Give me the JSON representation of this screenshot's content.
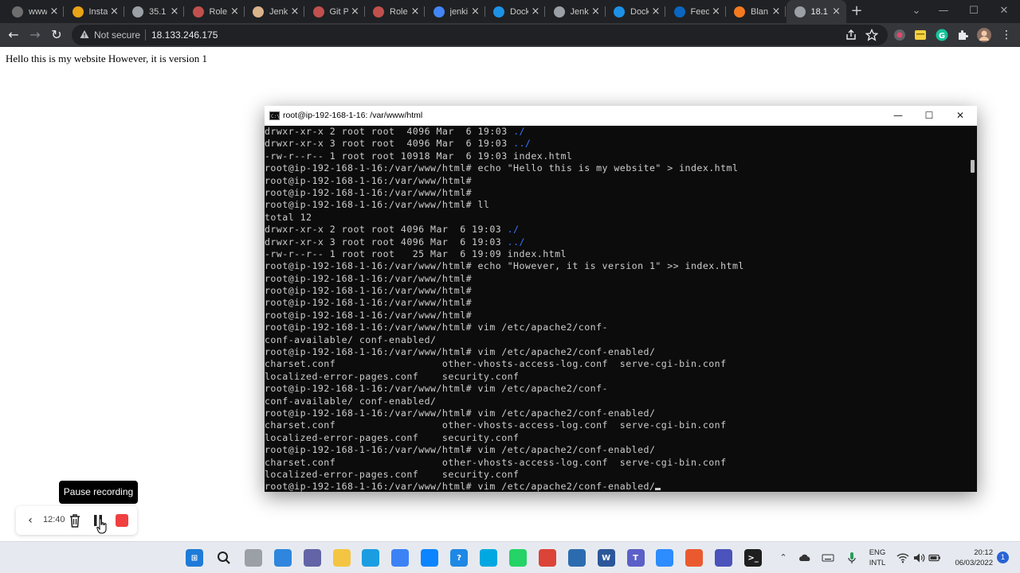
{
  "browser": {
    "tabs": [
      {
        "label": "www",
        "icon": "github-icon",
        "color": "#6e6e6e"
      },
      {
        "label": "Insta",
        "icon": "package-icon",
        "color": "#e8a317"
      },
      {
        "label": "35.1",
        "icon": "globe-icon",
        "color": "#9aa0a6"
      },
      {
        "label": "Role",
        "icon": "jenkins-icon",
        "color": "#c0504d"
      },
      {
        "label": "Jenk",
        "icon": "jenkins-icon",
        "color": "#d9b38c"
      },
      {
        "label": "Git P",
        "icon": "jenkins-icon",
        "color": "#c0504d"
      },
      {
        "label": "Role",
        "icon": "jenkins-icon",
        "color": "#c0504d"
      },
      {
        "label": "jenki",
        "icon": "google-icon",
        "color": "#4285f4"
      },
      {
        "label": "Dock",
        "icon": "docker-icon",
        "color": "#1d91e6"
      },
      {
        "label": "Jenk",
        "icon": "globe-icon",
        "color": "#9aa0a6"
      },
      {
        "label": "Dock",
        "icon": "docker-icon",
        "color": "#1d91e6"
      },
      {
        "label": "Feed",
        "icon": "linkedin-icon",
        "color": "#0a66c2"
      },
      {
        "label": "Blan",
        "icon": "aws-icon",
        "color": "#f47a20"
      },
      {
        "label": "18.1",
        "icon": "globe-icon",
        "color": "#9aa0a6"
      }
    ],
    "address": {
      "security_text": "Not secure",
      "url": "18.133.246.175"
    }
  },
  "page": {
    "body_text": "Hello this is my website However, it is version 1"
  },
  "terminal": {
    "title": "root@ip-192-168-1-16: /var/www/html",
    "lines": [
      {
        "text": "drwxr-xr-x 2 root root  4096 Mar  6 19:03 ",
        "dir": "./"
      },
      {
        "text": "drwxr-xr-x 3 root root  4096 Mar  6 19:03 ",
        "dir": "../"
      },
      {
        "text": "-rw-r--r-- 1 root root 10918 Mar  6 19:03 index.html"
      },
      {
        "text": "root@ip-192-168-1-16:/var/www/html# echo \"Hello this is my website\" > index.html"
      },
      {
        "text": "root@ip-192-168-1-16:/var/www/html#"
      },
      {
        "text": "root@ip-192-168-1-16:/var/www/html#"
      },
      {
        "text": "root@ip-192-168-1-16:/var/www/html# ll"
      },
      {
        "text": "total 12"
      },
      {
        "text": "drwxr-xr-x 2 root root 4096 Mar  6 19:03 ",
        "dir": "./"
      },
      {
        "text": "drwxr-xr-x 3 root root 4096 Mar  6 19:03 ",
        "dir": "../"
      },
      {
        "text": "-rw-r--r-- 1 root root   25 Mar  6 19:09 index.html"
      },
      {
        "text": "root@ip-192-168-1-16:/var/www/html# echo \"However, it is version 1\" >> index.html"
      },
      {
        "text": "root@ip-192-168-1-16:/var/www/html#"
      },
      {
        "text": "root@ip-192-168-1-16:/var/www/html#"
      },
      {
        "text": "root@ip-192-168-1-16:/var/www/html#"
      },
      {
        "text": "root@ip-192-168-1-16:/var/www/html#"
      },
      {
        "text": "root@ip-192-168-1-16:/var/www/html# vim /etc/apache2/conf-"
      },
      {
        "text": "conf-available/ conf-enabled/"
      },
      {
        "text": "root@ip-192-168-1-16:/var/www/html# vim /etc/apache2/conf-enabled/"
      },
      {
        "text": "charset.conf                  other-vhosts-access-log.conf  serve-cgi-bin.conf"
      },
      {
        "text": "localized-error-pages.conf    security.conf"
      },
      {
        "text": "root@ip-192-168-1-16:/var/www/html# vim /etc/apache2/conf-"
      },
      {
        "text": "conf-available/ conf-enabled/"
      },
      {
        "text": "root@ip-192-168-1-16:/var/www/html# vim /etc/apache2/conf-enabled/"
      },
      {
        "text": "charset.conf                  other-vhosts-access-log.conf  serve-cgi-bin.conf"
      },
      {
        "text": "localized-error-pages.conf    security.conf"
      },
      {
        "text": "root@ip-192-168-1-16:/var/www/html# vim /etc/apache2/conf-enabled/"
      },
      {
        "text": "charset.conf                  other-vhosts-access-log.conf  serve-cgi-bin.conf"
      },
      {
        "text": "localized-error-pages.conf    security.conf"
      },
      {
        "text": "root@ip-192-168-1-16:/var/www/html# vim /etc/apache2/conf-enabled/",
        "cursor": true
      }
    ],
    "colors": {
      "background": "#0c0c0c",
      "text": "#cccccc",
      "directory": "#3b78ff"
    }
  },
  "recorder": {
    "tooltip": "Pause recording",
    "elapsed": "12:40"
  },
  "taskbar": {
    "apps": [
      {
        "name": "start-icon",
        "color": "#1e7bd8",
        "glyph": "⊞"
      },
      {
        "name": "search-icon",
        "color": "#e6eaf0",
        "glyph": ""
      },
      {
        "name": "task-view-icon",
        "color": "#9aa0a6",
        "glyph": ""
      },
      {
        "name": "widgets-icon",
        "color": "#2e86de",
        "glyph": ""
      },
      {
        "name": "chat-icon",
        "color": "#6264a7",
        "glyph": ""
      },
      {
        "name": "file-explorer-icon",
        "color": "#f4c542",
        "glyph": ""
      },
      {
        "name": "edge-icon",
        "color": "#1b9de2",
        "glyph": ""
      },
      {
        "name": "store-icon",
        "color": "#3b82f6",
        "glyph": ""
      },
      {
        "name": "edge-dev-icon",
        "color": "#0a84ff",
        "glyph": ""
      },
      {
        "name": "help-icon",
        "color": "#1e88e5",
        "glyph": "?"
      },
      {
        "name": "alexa-icon",
        "color": "#00a8e1",
        "glyph": ""
      },
      {
        "name": "whatsapp-icon",
        "color": "#25d366",
        "glyph": ""
      },
      {
        "name": "chrome-icon",
        "color": "#db4437",
        "glyph": ""
      },
      {
        "name": "snipping-tool-icon",
        "color": "#2b6cb0",
        "glyph": ""
      },
      {
        "name": "word-icon",
        "color": "#2b579a",
        "glyph": "W"
      },
      {
        "name": "teams-icon",
        "color": "#5b5fc7",
        "glyph": "T"
      },
      {
        "name": "zoom-icon",
        "color": "#2d8cff",
        "glyph": ""
      },
      {
        "name": "office-icon",
        "color": "#eb5a2f",
        "glyph": ""
      },
      {
        "name": "teams-work-icon",
        "color": "#4b53bc",
        "glyph": ""
      },
      {
        "name": "terminal-icon",
        "color": "#1f1f1f",
        "glyph": ">_"
      }
    ],
    "language": {
      "line1": "ENG",
      "line2": "INTL"
    },
    "clock": {
      "time": "20:12",
      "date": "06/03/2022"
    },
    "notifications": "1"
  }
}
